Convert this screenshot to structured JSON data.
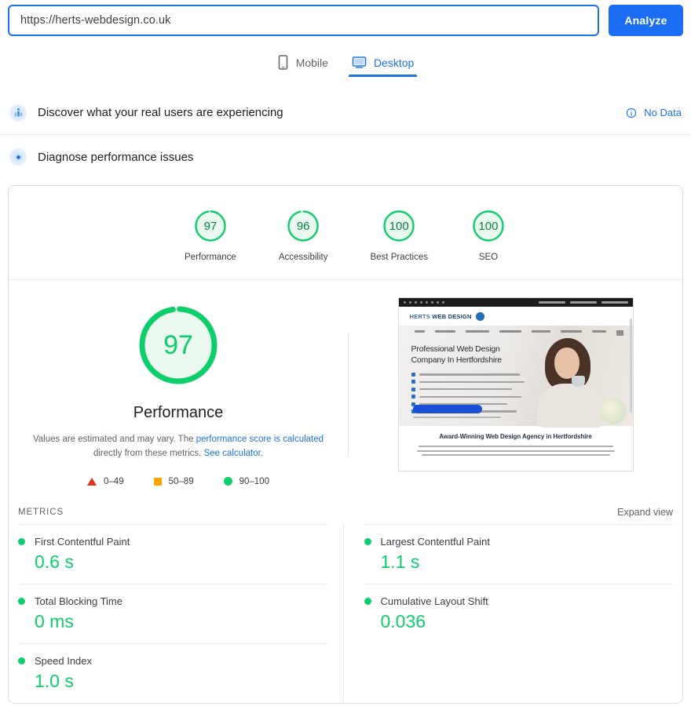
{
  "search": {
    "url_value": "https://herts-webdesign.co.uk",
    "analyze_label": "Analyze"
  },
  "device_tabs": [
    {
      "label": "Mobile",
      "icon": "mobile-icon",
      "active": false
    },
    {
      "label": "Desktop",
      "icon": "desktop-icon",
      "active": true
    }
  ],
  "sections": {
    "discover": {
      "title": "Discover what your real users are experiencing",
      "icon": "field-data-icon",
      "status": "No Data",
      "status_icon": "info-icon"
    },
    "diagnose": {
      "title": "Diagnose performance issues",
      "icon": "lighthouse-icon"
    }
  },
  "category_scores": [
    {
      "label": "Performance",
      "value": "97"
    },
    {
      "label": "Accessibility",
      "value": "96"
    },
    {
      "label": "Best Practices",
      "value": "100"
    },
    {
      "label": "SEO",
      "value": "100"
    }
  ],
  "performance_gauge": {
    "value": "97",
    "title": "Performance",
    "note_part1": "Values are estimated and may vary. The ",
    "note_link1": "performance score is calculated",
    "note_part2": " directly from these metrics. ",
    "note_link2": "See calculator",
    "note_part3": "."
  },
  "legend": [
    {
      "range": "0–49",
      "shape": "triangle",
      "color": "#e63022"
    },
    {
      "range": "50–89",
      "shape": "square",
      "color": "#ffa400"
    },
    {
      "range": "90–100",
      "shape": "circle",
      "color": "#0cce6b"
    }
  ],
  "metrics_section": {
    "header": "METRICS",
    "expand_label": "Expand view",
    "left_column": [
      {
        "name": "First Contentful Paint",
        "value": "0.6 s",
        "status_color": "#0cce6b"
      },
      {
        "name": "Total Blocking Time",
        "value": "0 ms",
        "status_color": "#0cce6b"
      },
      {
        "name": "Speed Index",
        "value": "1.0 s",
        "status_color": "#0cce6b"
      }
    ],
    "right_column": [
      {
        "name": "Largest Contentful Paint",
        "value": "1.1 s",
        "status_color": "#0cce6b"
      },
      {
        "name": "Cumulative Layout Shift",
        "value": "0.036",
        "status_color": "#0cce6b"
      }
    ]
  },
  "thumbnail": {
    "alt": "page-screenshot",
    "logo_text_1": "HERTS",
    "logo_text_2": "WEB DESIGN",
    "headline_line1": "Professional Web Design",
    "headline_line2": "Company In Hertfordshire",
    "section_heading": "Award-Winning Web Design Agency in Hertfordshire"
  },
  "colors": {
    "accent_blue": "#1a73e8",
    "button_blue": "#1b6ef3",
    "score_green": "#0cce6b",
    "score_green_dark": "#0b8043",
    "orange": "#ffa400",
    "red": "#e63022",
    "border": "#dadce0"
  }
}
